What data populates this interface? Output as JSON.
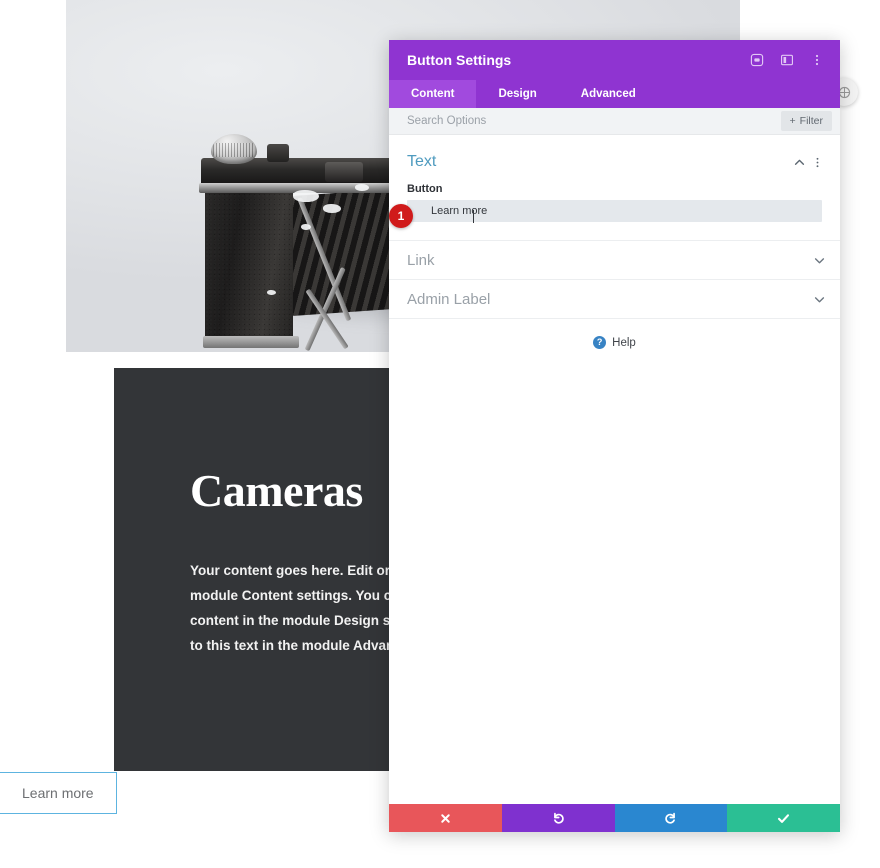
{
  "page": {
    "hero": {
      "alt": "vintage folding camera on light gray background"
    },
    "dark_panel": {
      "heading": "Cameras",
      "body": "Your content goes here. Edit or remove this text inline or in the module Content settings. You can also style every aspect of this content in the module Design settings and even apply custom CSS to this text in the module Advanced settings."
    },
    "cta": {
      "label": "Learn more"
    },
    "drag_handle": {
      "icon": "move-handle-icon"
    }
  },
  "modal": {
    "title": "Button Settings",
    "title_icons": [
      {
        "name": "focus-target-icon",
        "glyph": "focus"
      },
      {
        "name": "layout-panel-icon",
        "glyph": "panel"
      },
      {
        "name": "more-options-icon",
        "glyph": "dots"
      }
    ],
    "tabs": [
      {
        "label": "Content",
        "active": true
      },
      {
        "label": "Design",
        "active": false
      },
      {
        "label": "Advanced",
        "active": false
      }
    ],
    "search": {
      "placeholder": "Search Options",
      "value": ""
    },
    "filter_button": {
      "label": "Filter",
      "icon": "plus-icon"
    },
    "section": {
      "title": "Text",
      "collapse_icon": "chevron-up-icon",
      "menu_icon": "more-options-icon"
    },
    "field": {
      "label": "Button",
      "value": "Learn more",
      "step_badge": "1"
    },
    "accordions": [
      {
        "label": "Link",
        "icon": "chevron-down-icon"
      },
      {
        "label": "Admin Label",
        "icon": "chevron-down-icon"
      }
    ],
    "help": {
      "label": "Help",
      "icon": "question-mark-icon"
    },
    "footer_buttons": [
      {
        "name": "cancel-button",
        "icon": "close-x-icon",
        "color": "#e8565a"
      },
      {
        "name": "undo-button",
        "icon": "undo-arrow-icon",
        "color": "#7f31cf"
      },
      {
        "name": "redo-button",
        "icon": "redo-arrow-icon",
        "color": "#2a87d0"
      },
      {
        "name": "save-button",
        "icon": "checkmark-icon",
        "color": "#2bbf94"
      }
    ]
  },
  "colors": {
    "modal_purple": "#8f34d1",
    "tab_active": "#a14ade",
    "section_title": "#4f9bbf",
    "badge_red": "#d01b1b",
    "dark_panel": "#333538",
    "cta_border": "#5db4e0"
  }
}
